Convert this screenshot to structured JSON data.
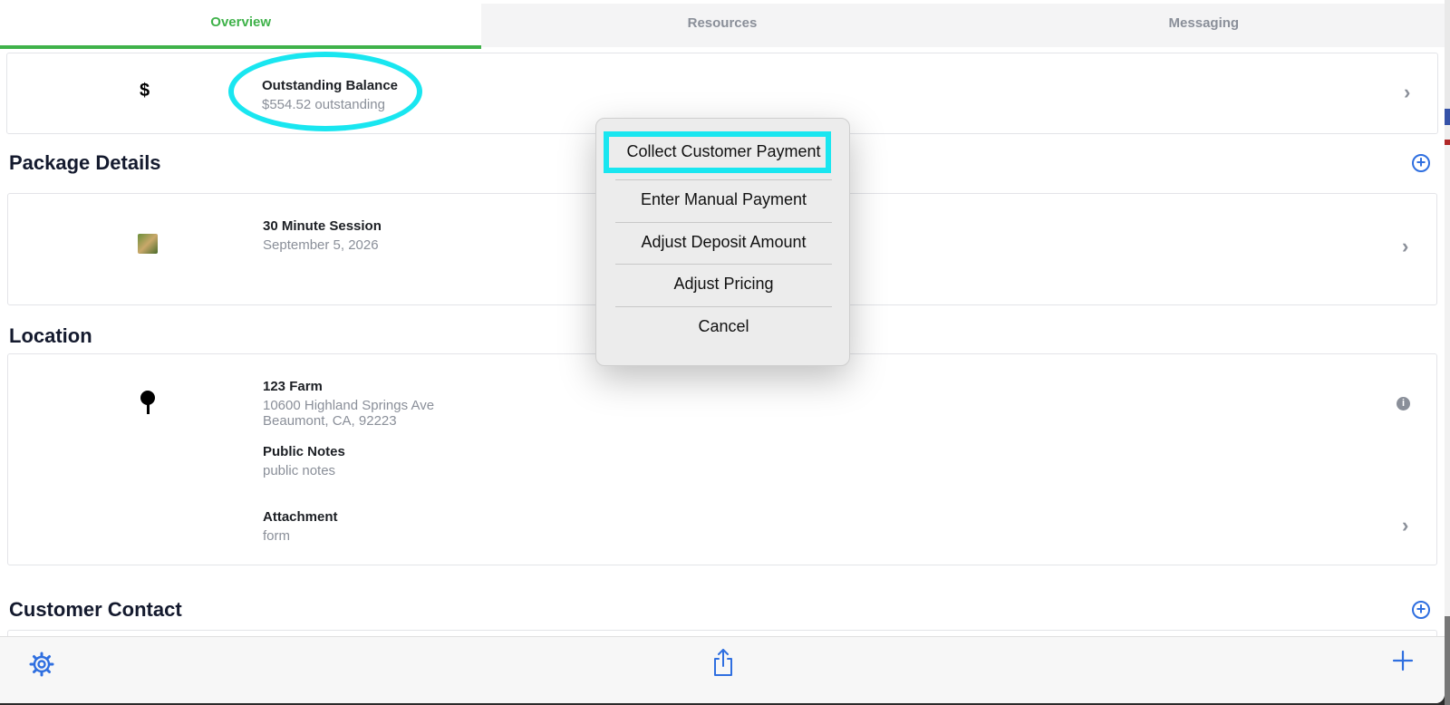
{
  "tabs": [
    {
      "label": "Overview",
      "active": true
    },
    {
      "label": "Resources",
      "active": false
    },
    {
      "label": "Messaging",
      "active": false
    }
  ],
  "balance": {
    "icon": "dollar-icon",
    "icon_glyph": "$",
    "title": "Outstanding Balance",
    "subtitle": "$554.52 outstanding"
  },
  "package": {
    "heading": "Package Details",
    "title": "30 Minute Session",
    "date": "September 5, 2026"
  },
  "location": {
    "heading": "Location",
    "name": "123 Farm",
    "address_line1": "10600 Highland Springs Ave",
    "address_line2": "Beaumont, CA, 92223",
    "notes_label": "Public Notes",
    "notes_value": "public notes",
    "attachment_label": "Attachment",
    "attachment_value": "form"
  },
  "contact": {
    "heading": "Customer Contact"
  },
  "action_sheet": {
    "items": [
      "Collect Customer Payment",
      "Enter Manual Payment",
      "Adjust Deposit Amount",
      "Adjust Pricing",
      "Cancel"
    ]
  },
  "colors": {
    "accent_green": "#3fb24a",
    "accent_blue": "#2f6fe0",
    "highlight_cyan": "#19e6f0"
  }
}
